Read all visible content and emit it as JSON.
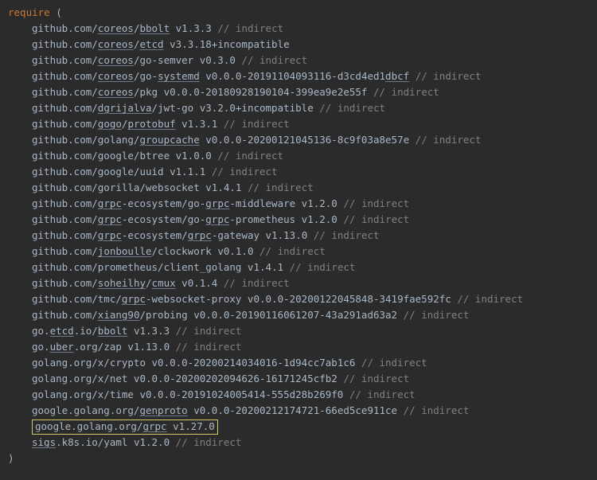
{
  "header": {
    "keyword": "require",
    "open": " ("
  },
  "footer": {
    "close": ")"
  },
  "lines": [
    {
      "segs": [
        {
          "t": "github.com/"
        },
        {
          "t": "coreos",
          "u": 1
        },
        {
          "t": "/"
        },
        {
          "t": "bbolt",
          "u": 1
        },
        {
          "t": " v1.3.3 "
        },
        {
          "t": "// indirect",
          "d": 1
        }
      ]
    },
    {
      "segs": [
        {
          "t": "github.com/"
        },
        {
          "t": "coreos",
          "u": 1
        },
        {
          "t": "/"
        },
        {
          "t": "etcd",
          "u": 1
        },
        {
          "t": " v3.3.18+incompatible"
        }
      ]
    },
    {
      "segs": [
        {
          "t": "github.com/"
        },
        {
          "t": "coreos",
          "u": 1
        },
        {
          "t": "/go-semver v0.3.0 "
        },
        {
          "t": "// indirect",
          "d": 1
        }
      ]
    },
    {
      "segs": [
        {
          "t": "github.com/"
        },
        {
          "t": "coreos",
          "u": 1
        },
        {
          "t": "/go-"
        },
        {
          "t": "systemd",
          "u": 1
        },
        {
          "t": " v0.0.0-20191104093116-d3cd4ed1"
        },
        {
          "t": "dbcf",
          "u": 1
        },
        {
          "t": " "
        },
        {
          "t": "// indirect",
          "d": 1
        }
      ]
    },
    {
      "segs": [
        {
          "t": "github.com/"
        },
        {
          "t": "coreos",
          "u": 1
        },
        {
          "t": "/pkg v0.0.0-20180928190104-399ea9e2e55f "
        },
        {
          "t": "// indirect",
          "d": 1
        }
      ]
    },
    {
      "segs": [
        {
          "t": "github.com/"
        },
        {
          "t": "dgrijalva",
          "u": 1
        },
        {
          "t": "/jwt-go v3.2.0+incompatible "
        },
        {
          "t": "// indirect",
          "d": 1
        }
      ]
    },
    {
      "segs": [
        {
          "t": "github.com/"
        },
        {
          "t": "gogo",
          "u": 1
        },
        {
          "t": "/"
        },
        {
          "t": "protobuf",
          "u": 1
        },
        {
          "t": " v1.3.1 "
        },
        {
          "t": "// indirect",
          "d": 1
        }
      ]
    },
    {
      "segs": [
        {
          "t": "github.com/golang/"
        },
        {
          "t": "groupcache",
          "u": 1
        },
        {
          "t": " v0.0.0-20200121045136-8c9f03a8e57e "
        },
        {
          "t": "// indirect",
          "d": 1
        }
      ]
    },
    {
      "segs": [
        {
          "t": "github.com/google/btree v1.0.0 "
        },
        {
          "t": "// indirect",
          "d": 1
        }
      ]
    },
    {
      "segs": [
        {
          "t": "github.com/google/uuid v1.1.1 "
        },
        {
          "t": "// indirect",
          "d": 1
        }
      ]
    },
    {
      "segs": [
        {
          "t": "github.com/gorilla/websocket v1.4.1 "
        },
        {
          "t": "// indirect",
          "d": 1
        }
      ]
    },
    {
      "segs": [
        {
          "t": "github.com/"
        },
        {
          "t": "grpc",
          "u": 1
        },
        {
          "t": "-ecosystem/go-"
        },
        {
          "t": "grpc",
          "u": 1
        },
        {
          "t": "-middleware v1.2.0 "
        },
        {
          "t": "// indirect",
          "d": 1
        }
      ]
    },
    {
      "segs": [
        {
          "t": "github.com/"
        },
        {
          "t": "grpc",
          "u": 1
        },
        {
          "t": "-ecosystem/go-"
        },
        {
          "t": "grpc",
          "u": 1
        },
        {
          "t": "-prometheus v1.2.0 "
        },
        {
          "t": "// indirect",
          "d": 1
        }
      ]
    },
    {
      "segs": [
        {
          "t": "github.com/"
        },
        {
          "t": "grpc",
          "u": 1
        },
        {
          "t": "-ecosystem/"
        },
        {
          "t": "grpc",
          "u": 1
        },
        {
          "t": "-gateway v1.13.0 "
        },
        {
          "t": "// indirect",
          "d": 1
        }
      ]
    },
    {
      "segs": [
        {
          "t": "github.com/"
        },
        {
          "t": "jonboulle",
          "u": 1
        },
        {
          "t": "/clockwork v0.1.0 "
        },
        {
          "t": "// indirect",
          "d": 1
        }
      ]
    },
    {
      "segs": [
        {
          "t": "github.com/prometheus/client_golang v1.4.1 "
        },
        {
          "t": "// indirect",
          "d": 1
        }
      ]
    },
    {
      "segs": [
        {
          "t": "github.com/"
        },
        {
          "t": "soheilhy",
          "u": 1
        },
        {
          "t": "/"
        },
        {
          "t": "cmux",
          "u": 1
        },
        {
          "t": " v0.1.4 "
        },
        {
          "t": "// indirect",
          "d": 1
        }
      ]
    },
    {
      "segs": [
        {
          "t": "github.com/tmc/"
        },
        {
          "t": "grpc",
          "u": 1
        },
        {
          "t": "-websocket-proxy v0.0.0-20200122045848-3419fae592fc "
        },
        {
          "t": "// indirect",
          "d": 1
        }
      ]
    },
    {
      "segs": [
        {
          "t": "github.com/"
        },
        {
          "t": "xiang90",
          "u": 1
        },
        {
          "t": "/probing v0.0.0-20190116061207-43a291ad63a2 "
        },
        {
          "t": "// indirect",
          "d": 1
        }
      ]
    },
    {
      "segs": [
        {
          "t": "go."
        },
        {
          "t": "etcd",
          "u": 1
        },
        {
          "t": ".io/"
        },
        {
          "t": "bbolt",
          "u": 1
        },
        {
          "t": " v1.3.3 "
        },
        {
          "t": "// indirect",
          "d": 1
        }
      ]
    },
    {
      "segs": [
        {
          "t": "go."
        },
        {
          "t": "uber",
          "u": 1
        },
        {
          "t": ".org/zap v1.13.0 "
        },
        {
          "t": "// indirect",
          "d": 1
        }
      ]
    },
    {
      "segs": [
        {
          "t": "golang.org/x/crypto v0.0.0-20200214034016-1d94cc7ab1c6 "
        },
        {
          "t": "// indirect",
          "d": 1
        }
      ]
    },
    {
      "segs": [
        {
          "t": "golang.org/x/net v0.0.0-20200202094626-16171245cfb2 "
        },
        {
          "t": "// indirect",
          "d": 1
        }
      ]
    },
    {
      "segs": [
        {
          "t": "golang.org/x/time v0.0.0-20191024005414-555d28b269f0 "
        },
        {
          "t": "// indirect",
          "d": 1
        }
      ]
    },
    {
      "segs": [
        {
          "t": "google.golang.org/"
        },
        {
          "t": "genproto",
          "u": 1
        },
        {
          "t": " v0.0.0-20200212174721-66ed5ce911ce "
        },
        {
          "t": "// indirect",
          "d": 1
        }
      ]
    },
    {
      "boxed": true,
      "segs": [
        {
          "t": "google.golang.org/"
        },
        {
          "t": "grpc",
          "u": 1
        },
        {
          "t": " v1.27.0"
        }
      ]
    },
    {
      "segs": [
        {
          "t": "sigs",
          "u": 1
        },
        {
          "t": ".k8s.io/yaml v1.2.0 "
        },
        {
          "t": "// indirect",
          "d": 1
        }
      ]
    }
  ]
}
